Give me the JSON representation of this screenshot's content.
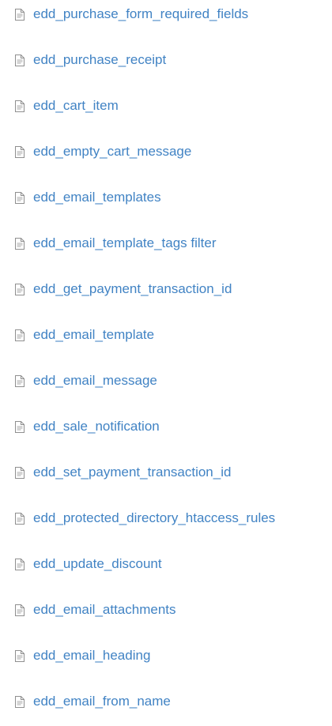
{
  "file_list": {
    "icon": "document-file-icon",
    "link_color": "#4183c4",
    "items": [
      {
        "label": "edd_purchase_form_required_fields"
      },
      {
        "label": "edd_purchase_receipt"
      },
      {
        "label": "edd_cart_item"
      },
      {
        "label": "edd_empty_cart_message"
      },
      {
        "label": "edd_email_templates"
      },
      {
        "label": "edd_email_template_tags filter"
      },
      {
        "label": "edd_get_payment_transaction_id"
      },
      {
        "label": "edd_email_template"
      },
      {
        "label": "edd_email_message"
      },
      {
        "label": "edd_sale_notification"
      },
      {
        "label": "edd_set_payment_transaction_id"
      },
      {
        "label": "edd_protected_directory_htaccess_rules"
      },
      {
        "label": "edd_update_discount"
      },
      {
        "label": "edd_email_attachments"
      },
      {
        "label": "edd_email_heading"
      },
      {
        "label": "edd_email_from_name"
      }
    ]
  }
}
